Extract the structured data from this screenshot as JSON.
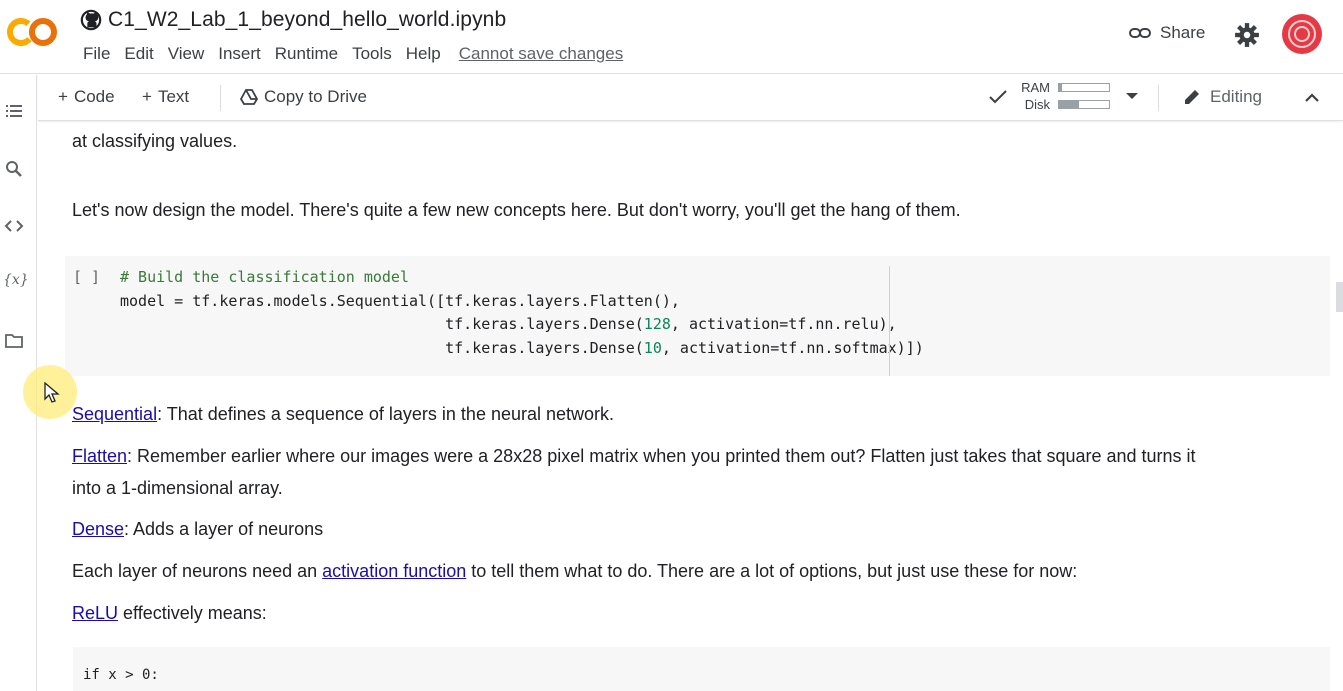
{
  "header": {
    "logo_text": "CO",
    "title": "C1_W2_Lab_1_beyond_hello_world.ipynb",
    "menu": [
      "File",
      "Edit",
      "View",
      "Insert",
      "Runtime",
      "Tools",
      "Help"
    ],
    "save_status": "Cannot save changes",
    "share_label": "Share"
  },
  "toolbar": {
    "code_label": "Code",
    "text_label": "Text",
    "copy_to_drive_label": "Copy to Drive",
    "ram_label": "RAM",
    "disk_label": "Disk",
    "ram_usage": 0.05,
    "disk_usage": 0.4,
    "editing_label": "Editing"
  },
  "sidebar": {
    "icons": [
      "toc-icon",
      "search-icon",
      "code-snippets-icon",
      "variables-icon",
      "files-icon"
    ]
  },
  "content": {
    "line1": "at classifying values.",
    "line2": "Let's now design the model. There's quite a few new concepts here. But don't worry, you'll get the hang of them.",
    "code_bracket": "[ ]",
    "code_comment": "# Build the classification model",
    "code_l2": "model = tf.keras.models.Sequential([tf.keras.layers.Flatten(),",
    "code_l3a": "tf.keras.layers.Dense(",
    "code_l3num": "128",
    "code_l3b": ", activation=tf.nn.relu),",
    "code_l4a": "tf.keras.layers.Dense(",
    "code_l4num": "10",
    "code_l4b": ", activation=tf.nn.softmax)])",
    "sequential_link": "Sequential",
    "sequential_text": ": That defines a sequence of layers in the neural network.",
    "flatten_link": "Flatten",
    "flatten_text1": ": Remember earlier where our images were a 28x28 pixel matrix when you printed them out? Flatten just takes that square and turns it",
    "flatten_text2": "into a 1-dimensional array.",
    "dense_link": "Dense",
    "dense_text": ": Adds a layer of neurons",
    "activation_pre": "Each layer of neurons need an ",
    "activation_link": "activation function",
    "activation_post": " to tell them what to do. There are a lot of options, but just use these for now:",
    "relu_link": "ReLU",
    "relu_text": " effectively means:",
    "code2_line": "if x > 0:"
  },
  "colors": {
    "logo_orange": "#f9ab00",
    "link": "#1a0dab",
    "avatar": "#e53945",
    "code_bg": "#f7f7f7",
    "comment": "#3a7a3a",
    "number": "#098658"
  }
}
